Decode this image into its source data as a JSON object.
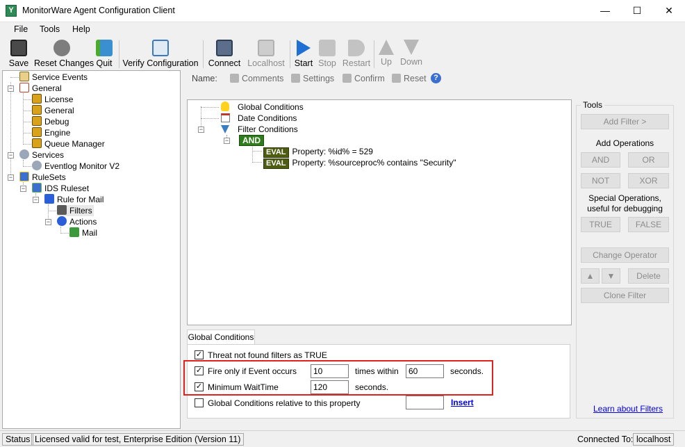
{
  "window": {
    "title": "MonitorWare Agent Configuration Client",
    "minimize": "—",
    "maximize": "☐",
    "close": "✕"
  },
  "menu": [
    "File",
    "Tools",
    "Help"
  ],
  "toolbar": {
    "save": "Save",
    "reset_changes": "Reset Changes",
    "quit": "Quit",
    "verify": "Verify Configuration",
    "connect": "Connect",
    "localhost": "Localhost",
    "start": "Start",
    "stop": "Stop",
    "restart": "Restart",
    "up": "Up",
    "down": "Down"
  },
  "tree": {
    "service_events": "Service Events",
    "general": "General",
    "license": "License",
    "general_sub": "General",
    "debug": "Debug",
    "engine": "Engine",
    "queue_manager": "Queue Manager",
    "services": "Services",
    "eventlog_monitor": "Eventlog Monitor V2",
    "rulesets": "RuleSets",
    "ids_ruleset": "IDS Ruleset",
    "rule_for_mail": "Rule for Mail",
    "filters": "Filters",
    "actions": "Actions",
    "mail": "Mail"
  },
  "subtoolbar": {
    "name": "Name:",
    "comments": "Comments",
    "settings": "Settings",
    "confirm": "Confirm",
    "reset": "Reset"
  },
  "filter_tree": {
    "global_conditions": "Global Conditions",
    "date_conditions": "Date Conditions",
    "filter_conditions": "Filter Conditions",
    "and": "AND",
    "eval": "EVAL",
    "cond1": "Property: %id% = 529",
    "cond2": "Property: %sourceproc% contains \"Security\""
  },
  "tools": {
    "title": "Tools",
    "add_filter": "Add Filter >",
    "add_operations": "Add Operations",
    "and": "AND",
    "or": "OR",
    "not": "NOT",
    "xor": "XOR",
    "special_ops_line1": "Special Operations,",
    "special_ops_line2": "useful for debugging",
    "true": "TRUE",
    "false": "FALSE",
    "change_operator": "Change Operator",
    "delete": "Delete",
    "clone_filter": "Clone Filter",
    "learn": "Learn about Filters"
  },
  "global_conditions": {
    "tab": "Global Conditions",
    "treat_not_found": "Threat not found filters as TRUE",
    "fire_only": "Fire only if Event occurs",
    "fire_count": "10",
    "times_within": "times within",
    "fire_seconds": "60",
    "seconds1": "seconds.",
    "min_wait": "Minimum WaitTime",
    "min_wait_value": "120",
    "seconds2": "seconds.",
    "relative": "Global Conditions relative to this property",
    "relative_value": "",
    "insert": "Insert"
  },
  "status": {
    "label": "Status",
    "license": "Licensed valid for test, Enterprise Edition (Version 11)",
    "connected_to": "Connected To:",
    "host": "localhost"
  }
}
